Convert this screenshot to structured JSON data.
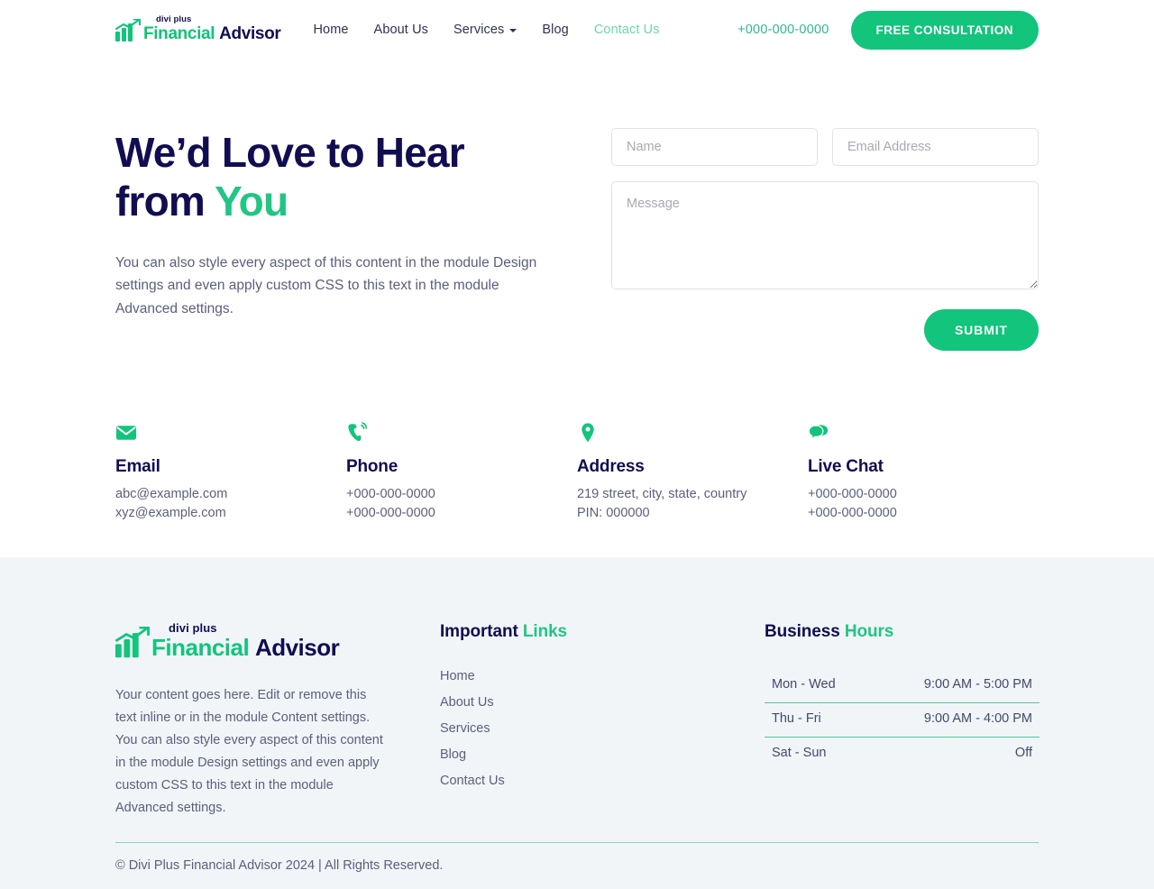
{
  "colors": {
    "brand_green": "#12c47c",
    "accent_green": "#21c584",
    "navy": "#110d51",
    "body_text": "#5b5f7c",
    "footer_bg": "#f1f5f8",
    "nav_active": "#6ed6aa",
    "divider_green": "#85d6b4"
  },
  "header": {
    "logo": {
      "eyebrow": "divi plus",
      "word_green": "Financial",
      "word_dark": "Advisor",
      "icon": "bar-chart-growth-icon"
    },
    "nav": [
      {
        "label": "Home",
        "active": false,
        "has_caret": false
      },
      {
        "label": "About Us",
        "active": false,
        "has_caret": false
      },
      {
        "label": "Services",
        "active": false,
        "has_caret": true
      },
      {
        "label": "Blog",
        "active": false,
        "has_caret": false
      },
      {
        "label": "Contact Us",
        "active": true,
        "has_caret": false
      }
    ],
    "phone": "+000-000-0000",
    "cta_label": "FREE CONSULTATION"
  },
  "hero": {
    "title_line1": "We’d Love to Hear",
    "title_line2_plain": "from ",
    "title_line2_accent": "You",
    "paragraph": "You can also style every aspect of this content in the module Design settings and even apply custom CSS to this text in the module Advanced settings."
  },
  "form": {
    "name_placeholder": "Name",
    "name_value": "",
    "email_placeholder": "Email Address",
    "email_value": "",
    "message_placeholder": "Message",
    "message_value": "",
    "submit_label": "SUBMIT"
  },
  "contact_cards": [
    {
      "icon": "envelope-icon",
      "title": "Email",
      "line1": "abc@example.com",
      "line2": "xyz@example.com"
    },
    {
      "icon": "phone-ringing-icon",
      "title": "Phone",
      "line1": "+000-000-0000",
      "line2": "+000-000-0000"
    },
    {
      "icon": "map-pin-icon",
      "title": "Address",
      "line1": "219 street, city, state, country",
      "line2": "PIN: 000000"
    },
    {
      "icon": "chat-bubbles-icon",
      "title": "Live Chat",
      "line1": "+000-000-0000",
      "line2": "+000-000-0000"
    }
  ],
  "footer": {
    "logo": {
      "eyebrow": "divi plus",
      "word_green": "Financial",
      "word_dark": "Advisor",
      "icon": "bar-chart-growth-icon"
    },
    "about_text": "Your content goes here. Edit or remove this text inline or in the module Content settings. You can also style every aspect of this content in the module Design settings and even apply custom CSS to this text in the module Advanced settings.",
    "links_heading_plain": "Important ",
    "links_heading_accent": "Links",
    "links": [
      {
        "label": "Home"
      },
      {
        "label": "About Us"
      },
      {
        "label": "Services"
      },
      {
        "label": "Blog"
      },
      {
        "label": "Contact Us"
      }
    ],
    "hours_heading_plain": "Business ",
    "hours_heading_accent": "Hours",
    "hours": [
      {
        "days": "Mon - Wed",
        "time": "9:00 AM - 5:00 PM"
      },
      {
        "days": "Thu - Fri",
        "time": "9:00 AM - 4:00 PM"
      },
      {
        "days": "Sat - Sun",
        "time": "Off"
      }
    ],
    "copyright": "© Divi Plus Financial Advisor 2024 | All Rights Reserved."
  }
}
